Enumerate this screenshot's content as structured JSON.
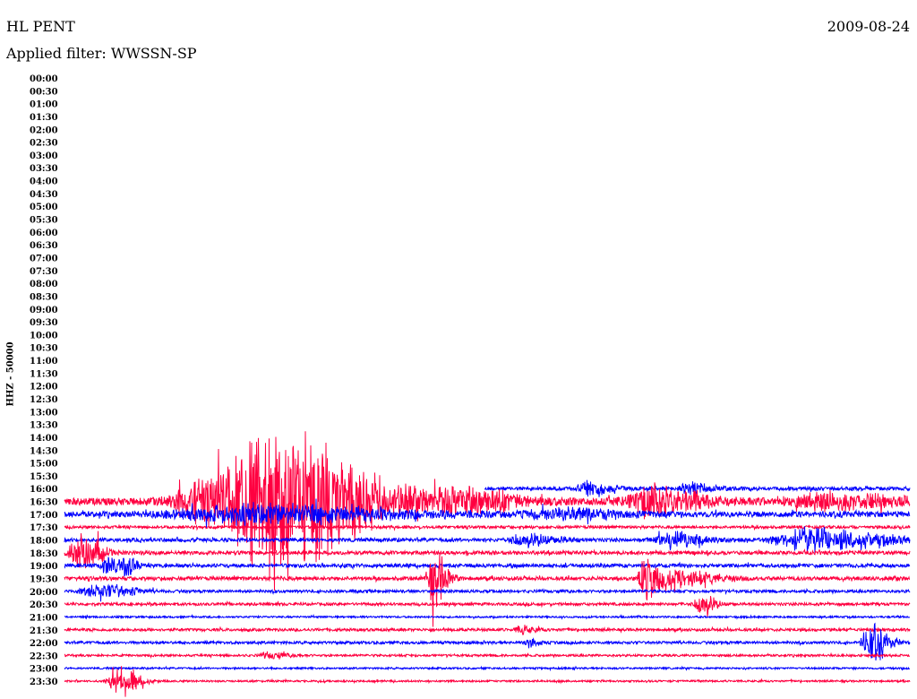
{
  "header": {
    "station": "HL PENT",
    "date": "2009-08-24",
    "filter": "Applied filter: WWSSN-SP"
  },
  "chart_data": {
    "type": "line",
    "title": "HL PENT",
    "ylabel": "HHZ - 50000",
    "row_minutes": 30,
    "colors": {
      "red": "#ff0040",
      "blue": "#0000ff"
    },
    "tick_labels": [
      "00:00",
      "00:30",
      "01:00",
      "01:30",
      "02:00",
      "02:30",
      "03:00",
      "03:30",
      "04:00",
      "04:30",
      "05:00",
      "05:30",
      "06:00",
      "06:30",
      "07:00",
      "07:30",
      "08:00",
      "08:30",
      "09:00",
      "09:30",
      "10:00",
      "10:30",
      "11:00",
      "11:30",
      "12:00",
      "12:30",
      "13:00",
      "13:30",
      "14:00",
      "14:30",
      "15:00",
      "15:30",
      "16:00",
      "16:30",
      "17:00",
      "17:30",
      "18:00",
      "18:30",
      "19:00",
      "19:30",
      "20:00",
      "20:30",
      "21:00",
      "21:30",
      "22:00",
      "22:30",
      "23:00",
      "23:30"
    ],
    "traces": [
      {
        "row": "16:00",
        "color": "blue",
        "start_min": 14.9,
        "noise": 2,
        "events": [
          {
            "min": 18.6,
            "amp": 8,
            "width": 0.6
          },
          {
            "min": 22.2,
            "amp": 6,
            "width": 0.6
          }
        ]
      },
      {
        "row": "16:30",
        "color": "red",
        "start_min": 0,
        "noise": 4,
        "events": [
          {
            "min": 7.4,
            "amp": 70,
            "width": 2.8
          },
          {
            "min": 5.0,
            "amp": 20,
            "width": 2.0
          },
          {
            "min": 14.0,
            "amp": 14,
            "width": 1.5
          },
          {
            "min": 20.8,
            "amp": 14,
            "width": 1.5
          },
          {
            "min": 27.0,
            "amp": 8,
            "width": 2.0
          }
        ]
      },
      {
        "row": "17:00",
        "color": "blue",
        "start_min": 0,
        "noise": 3,
        "events": [
          {
            "min": 6.5,
            "amp": 9,
            "width": 4.5
          },
          {
            "min": 17.5,
            "amp": 5,
            "width": 2
          }
        ]
      },
      {
        "row": "17:30",
        "color": "red",
        "start_min": 0,
        "noise": 1.5,
        "events": []
      },
      {
        "row": "18:00",
        "color": "blue",
        "start_min": 0,
        "noise": 2,
        "events": [
          {
            "min": 16.3,
            "amp": 6,
            "width": 1
          },
          {
            "min": 21.5,
            "amp": 8,
            "width": 1
          },
          {
            "min": 26.5,
            "amp": 12,
            "width": 2.2
          }
        ]
      },
      {
        "row": "18:30",
        "color": "red",
        "start_min": 0,
        "noise": 2,
        "events": [
          {
            "min": 0.5,
            "amp": 22,
            "width": 0.6
          }
        ]
      },
      {
        "row": "19:00",
        "color": "blue",
        "start_min": 0,
        "noise": 2,
        "events": [
          {
            "min": 1.5,
            "amp": 8,
            "width": 0.4
          },
          {
            "min": 2.2,
            "amp": 14,
            "width": 0.25
          }
        ]
      },
      {
        "row": "19:30",
        "color": "red",
        "start_min": 0,
        "noise": 2,
        "events": [
          {
            "min": 13.1,
            "amp": 26,
            "width": 0.4
          },
          {
            "min": 20.6,
            "amp": 24,
            "width": 0.4
          },
          {
            "min": 21.8,
            "amp": 8,
            "width": 1.2
          }
        ]
      },
      {
        "row": "20:00",
        "color": "blue",
        "start_min": 0,
        "noise": 1.5,
        "events": [
          {
            "min": 1.2,
            "amp": 8,
            "width": 1.0
          }
        ]
      },
      {
        "row": "20:30",
        "color": "red",
        "start_min": 0,
        "noise": 1.5,
        "events": [
          {
            "min": 22.6,
            "amp": 12,
            "width": 0.4
          }
        ]
      },
      {
        "row": "21:00",
        "color": "blue",
        "start_min": 0,
        "noise": 1,
        "events": []
      },
      {
        "row": "21:30",
        "color": "red",
        "start_min": 0,
        "noise": 1.5,
        "events": [
          {
            "min": 16.2,
            "amp": 4,
            "width": 0.4
          }
        ]
      },
      {
        "row": "22:00",
        "color": "blue",
        "start_min": 0,
        "noise": 1.5,
        "events": [
          {
            "min": 16.5,
            "amp": 4,
            "width": 0.3
          },
          {
            "min": 28.6,
            "amp": 20,
            "width": 0.5
          }
        ]
      },
      {
        "row": "22:30",
        "color": "red",
        "start_min": 0,
        "noise": 1.2,
        "events": [
          {
            "min": 7.3,
            "amp": 3,
            "width": 0.6
          }
        ]
      },
      {
        "row": "23:00",
        "color": "blue",
        "start_min": 0,
        "noise": 1,
        "events": []
      },
      {
        "row": "23:30",
        "color": "red",
        "start_min": 0,
        "noise": 1,
        "events": [
          {
            "min": 1.9,
            "amp": 16,
            "width": 0.6
          }
        ]
      }
    ]
  }
}
